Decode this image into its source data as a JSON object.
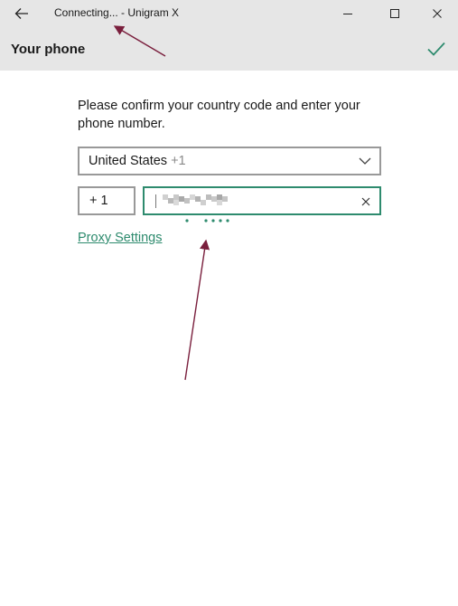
{
  "window": {
    "title": "Connecting... - Unigram X",
    "icons": {
      "back": "arrow-left-icon",
      "minimize": "minimize-icon",
      "maximize": "maximize-icon",
      "close": "close-icon"
    }
  },
  "header": {
    "title": "Your phone",
    "confirm_icon": "checkmark-icon"
  },
  "form": {
    "instructions": "Please confirm your country code and enter your phone number.",
    "country": {
      "name": "United States",
      "code": "+1",
      "icon": "chevron-down-icon"
    },
    "code_value": "+ 1",
    "phone": {
      "value_obscured": true,
      "clear_icon": "clear-icon"
    },
    "proxy_link": "Proxy Settings"
  },
  "colors": {
    "chrome_bg": "#e6e6e6",
    "accent": "#2e8b6e",
    "annotation": "#7a1f3d"
  }
}
